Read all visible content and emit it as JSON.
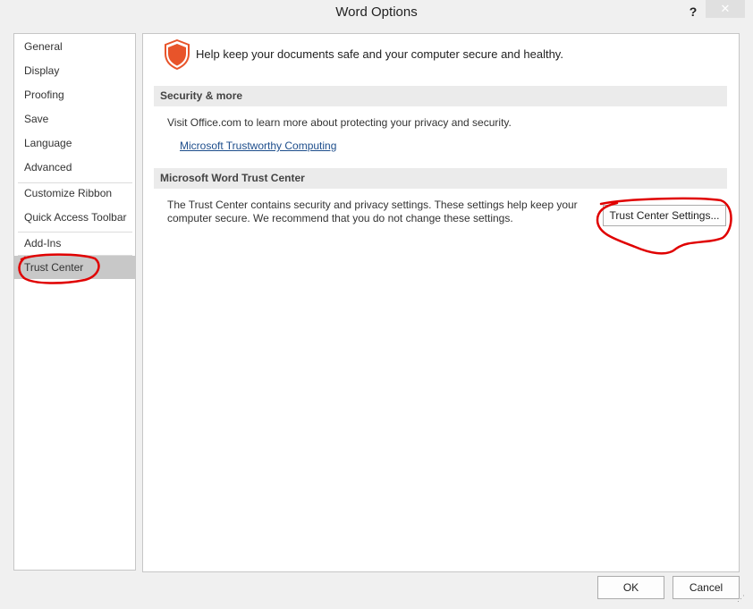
{
  "window": {
    "title": "Word Options",
    "help_label": "?",
    "close_label": "✕"
  },
  "sidebar": {
    "items": [
      {
        "label": "General"
      },
      {
        "label": "Display"
      },
      {
        "label": "Proofing"
      },
      {
        "label": "Save"
      },
      {
        "label": "Language"
      },
      {
        "label": "Advanced"
      },
      {
        "label": "Customize Ribbon"
      },
      {
        "label": "Quick Access Toolbar"
      },
      {
        "label": "Add-Ins"
      },
      {
        "label": "Trust Center",
        "selected": true
      }
    ]
  },
  "main": {
    "intro": "Help keep your documents safe and your computer secure and healthy.",
    "security_section": {
      "header": "Security & more",
      "text": "Visit Office.com to learn more about protecting your privacy and security.",
      "link": "Microsoft Trustworthy Computing"
    },
    "trust_section": {
      "header": "Microsoft Word Trust Center",
      "text_line1": "The Trust Center contains security and privacy settings. These settings help keep your",
      "text_line2": "computer secure. We recommend that you do not change these settings.",
      "button_label": "Trust Center Settings..."
    }
  },
  "footer": {
    "ok_label": "OK",
    "cancel_label": "Cancel"
  },
  "colors": {
    "shield": "#e8542a",
    "selected_nav": "#c8c8c8",
    "annotation": "#e00000",
    "link": "#1e4e8c"
  }
}
